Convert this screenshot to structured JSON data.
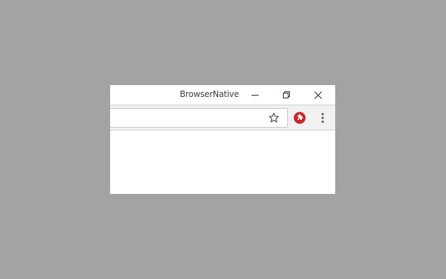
{
  "window": {
    "title": "BrowserNative"
  },
  "toolbar": {
    "address_value": "",
    "icons": {
      "bookmark": "star-icon",
      "extension": "extension-puzzle-icon",
      "menu": "kebab-menu-icon"
    }
  },
  "colors": {
    "desktop": "#a3a3a3",
    "extension_badge": "#c62828"
  }
}
